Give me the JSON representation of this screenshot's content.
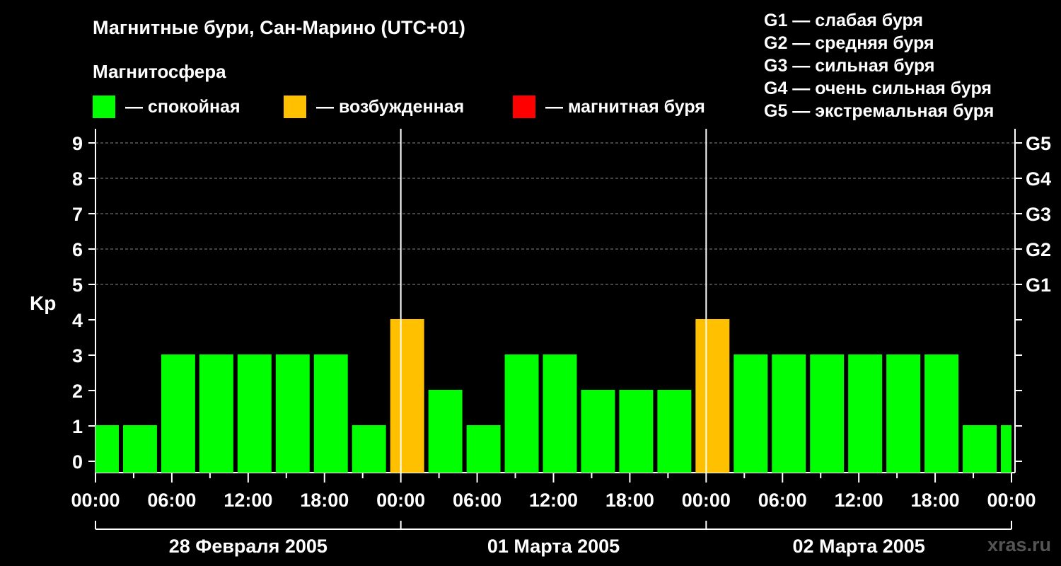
{
  "header": {
    "title": "Магнитные бури, Сан-Марино (UTC+01)",
    "subtitle": "Магнитосфера"
  },
  "legend": [
    {
      "label": "— спокойная",
      "color": "#00ff00"
    },
    {
      "label": "— возбужденная",
      "color": "#ffc000"
    },
    {
      "label": "— магнитная буря",
      "color": "#ff0000"
    }
  ],
  "storm_scale": [
    "G1 — слабая буря",
    "G2 — средняя буря",
    "G3 — сильная буря",
    "G4 — очень сильная буря",
    "G5 — экстремальная буря"
  ],
  "watermark": "xras.ru",
  "chart_data": {
    "type": "bar",
    "title": "Магнитные бури, Сан-Марино (UTC+01)",
    "ylabel": "Kp",
    "ylim": [
      0,
      9
    ],
    "yticks": [
      0,
      1,
      2,
      3,
      4,
      5,
      6,
      7,
      8,
      9
    ],
    "right_axis": [
      {
        "kp": 5,
        "label": "G1"
      },
      {
        "kp": 6,
        "label": "G2"
      },
      {
        "kp": 7,
        "label": "G3"
      },
      {
        "kp": 8,
        "label": "G4"
      },
      {
        "kp": 9,
        "label": "G5"
      }
    ],
    "x_start_hours": -1,
    "x_end_hours": 71,
    "x_range_hours": [
      0,
      72
    ],
    "xtick_labels": [
      "00:00",
      "06:00",
      "12:00",
      "18:00",
      "00:00",
      "06:00",
      "12:00",
      "18:00",
      "00:00",
      "06:00",
      "12:00",
      "18:00",
      "00:00"
    ],
    "days": [
      "28 Февраля 2005",
      "01 Марта 2005",
      "02 Марта 2005"
    ],
    "values": [
      1,
      1,
      3,
      3,
      3,
      3,
      3,
      1,
      4,
      2,
      1,
      3,
      3,
      2,
      2,
      2,
      4,
      3,
      3,
      3,
      3,
      3,
      3,
      1,
      1
    ],
    "colors": {
      "quiet": "#00ff00",
      "active": "#ffc000",
      "storm": "#ff0000"
    },
    "grid": true,
    "legend_position": "top"
  }
}
